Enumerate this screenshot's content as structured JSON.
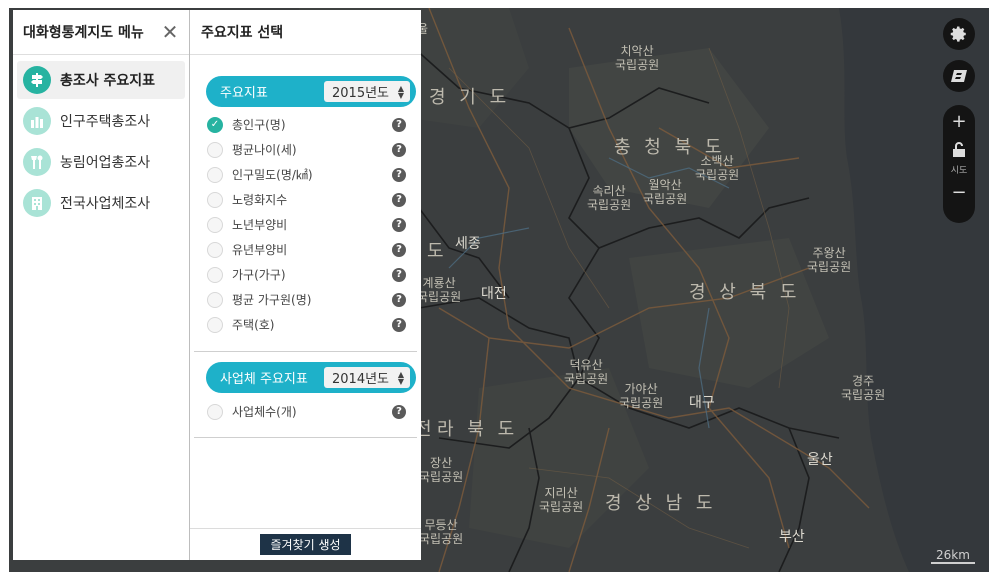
{
  "menu_panel": {
    "title": "대화형통계지도 메뉴",
    "items": [
      {
        "label": "총조사 주요지표",
        "active": true
      },
      {
        "label": "인구주택총조사",
        "active": false
      },
      {
        "label": "농림어업총조사",
        "active": false
      },
      {
        "label": "전국사업체조사",
        "active": false
      }
    ]
  },
  "indicator_panel": {
    "title": "주요지표 선택",
    "main_group": {
      "label": "주요지표",
      "year": "2015년도",
      "items": [
        {
          "label": "총인구(명)",
          "checked": true
        },
        {
          "label": "평균나이(세)",
          "checked": false
        },
        {
          "label": "인구밀도(명/㎢)",
          "checked": false
        },
        {
          "label": "노령화지수",
          "checked": false
        },
        {
          "label": "노년부양비",
          "checked": false
        },
        {
          "label": "유년부양비",
          "checked": false
        },
        {
          "label": "가구(가구)",
          "checked": false
        },
        {
          "label": "평균 가구원(명)",
          "checked": false
        },
        {
          "label": "주택(호)",
          "checked": false
        }
      ]
    },
    "business_group": {
      "label": "사업체 주요지표",
      "year": "2014년도",
      "items": [
        {
          "label": "사업체수(개)",
          "checked": false
        }
      ]
    },
    "favorite_button": "즐겨찾기 생성"
  },
  "map": {
    "labels": {
      "seoul_part": "울",
      "gyeonggi": "경 기 도",
      "chiaksan": "치악산\n국립공원",
      "chungbuk": "충 청 북 도",
      "sobaeksan": "소백산\n국립공원",
      "songnisan": "속리산\n국립공원",
      "woraksan": "월악산\n국립공원",
      "sejong": "세종",
      "chungnam_part": "도",
      "gyeryongsan": "계룡산\n국립공원",
      "daejeon": "대전",
      "gyeongbuk": "경 상 북 도",
      "juwangsan": "주왕산\n국립공원",
      "deogyusan": "덕유산\n국립공원",
      "gayasan": "가야산\n국립공원",
      "daegu": "대구",
      "gyeongju": "경주\n국립공원",
      "jeonbuk": "라 북 도",
      "jeonbuk_prefix": "전",
      "naejangsan": "장산\n국립공원",
      "jirisan": "지리산\n국립공원",
      "gyeongnam": "경 상 남 도",
      "ulsan": "울산",
      "mudeungsan": "무등산\n국립공원",
      "busan": "부산"
    },
    "scale": "26km",
    "zoom_label": "시도"
  },
  "icons": {
    "settings": "gear-icon",
    "layers": "layers-icon",
    "zoom_in": "plus-icon",
    "lock": "unlock-icon",
    "zoom_out": "minus-icon",
    "close": "close-icon",
    "check": "check-icon",
    "help": "help-icon"
  },
  "colors": {
    "accent_teal": "#27b3a1",
    "pill_cyan": "#1eb1c9",
    "footer_button": "#1e3347",
    "map_background": "#3a3d3e"
  }
}
